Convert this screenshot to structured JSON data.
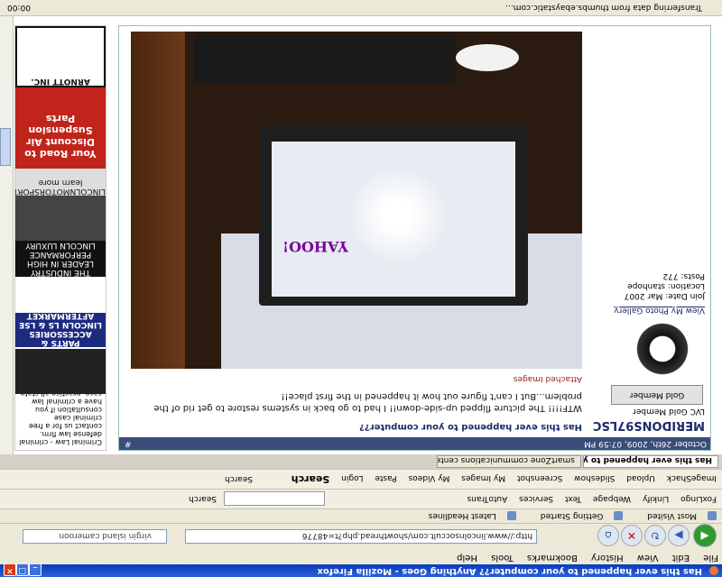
{
  "window": {
    "title": "Has this ever happened to your computer?? Anything Goes - Mozilla Firefox"
  },
  "menu": [
    "File",
    "Edit",
    "View",
    "History",
    "Bookmarks",
    "Tools",
    "Help"
  ],
  "nav": {
    "url": "http://www.lincolnsoccult.com/showthread.php?t=48776",
    "search_value": "virgin island cameroon"
  },
  "bookmarks": [
    "Most Visited",
    "Getting Started",
    "Latest Headlines"
  ],
  "toolbar": {
    "items": [
      "FoxLingo",
      "Linkify",
      "Webpage",
      "Text",
      "Services",
      "AutoTrans"
    ],
    "search_label": "Search"
  },
  "toolbar2": {
    "items": [
      "ImageShack",
      "Upload",
      "Slideshow",
      "Screenshot",
      "My Images",
      "My Videos",
      "Paste",
      "Login"
    ],
    "search_label": "Search",
    "small_search": "Search"
  },
  "tabs": [
    {
      "label": "Has this ever happened to your ...",
      "active": true
    },
    {
      "label": "smartZone communications center: In..."
    }
  ],
  "post": {
    "date": "October 26th, 2009, 07:59 PM",
    "number": "#",
    "username": "MERIDONS97LSC",
    "usertitle": "LVC Gold Member",
    "badge": "Gold Member",
    "gallery_link": "View My Photo Gallery",
    "join_date": "Join Date: Mar 2007",
    "location": "Location: stanhope",
    "posts": "Posts: 772",
    "title": "Has this ever happened to your computer??",
    "body": "WTF!!!! The picture flipped up-side-down!! I had to go back in systems restore to get rid of the problem...But I can't figure out how it happened in the first place!!",
    "attached_label": "Attached Images"
  },
  "photo": {
    "screen_brand": "YAHOO!"
  },
  "ads": {
    "legal": "Criminal Law - criminal defense law firm. contact us for a free criminal case consultation if you have a criminal law case. practice all state and federal criminal courts",
    "lincoln_else": "LINCOLN LS & LSE AFTERMARKET",
    "parts": "PARTS & ACCESSORIES",
    "industry": "THE INDUSTRY LEADER IN HIGH PERFORMANCE LINCOLN LUXURY",
    "lincolnmotorsport": "LINCOLNMOTORSPORT",
    "learn_more": "learn more",
    "discount": "Your Road to Discount Air Suspension Parts",
    "arnott": "ARNOTT INC."
  },
  "status": {
    "text": "Transferring data from thumbs.ebaystatic.com...",
    "timer": "00:00"
  }
}
